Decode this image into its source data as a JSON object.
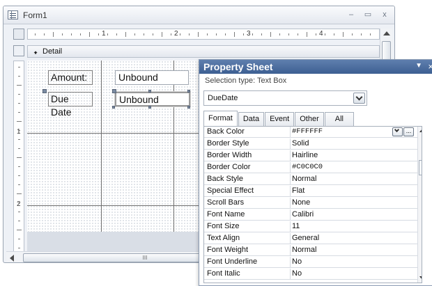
{
  "form_window": {
    "title": "Form1",
    "window_buttons": {
      "minimize": "–",
      "maximize": "▭",
      "close": "x"
    },
    "ruler_numbers": [
      "1",
      "2",
      "3",
      "4"
    ],
    "vruler_numbers": [
      "1",
      "2"
    ],
    "section_label": "Detail",
    "controls": [
      {
        "label": "Amount:",
        "textbox": "Unbound"
      },
      {
        "label": "Due Date",
        "textbox": "Unbound"
      }
    ],
    "scroll_grip": "III"
  },
  "property_sheet": {
    "title": "Property Sheet",
    "selection_type": "Selection type:  Text Box",
    "selected_object": "DueDate",
    "tabs": [
      "Format",
      "Data",
      "Event",
      "Other",
      "All"
    ],
    "active_tab": "Format",
    "properties": [
      {
        "name": "Back Color",
        "value": "#FFFFFF"
      },
      {
        "name": "Border Style",
        "value": "Solid"
      },
      {
        "name": "Border Width",
        "value": "Hairline"
      },
      {
        "name": "Border Color",
        "value": "#C0C0C0"
      },
      {
        "name": "Back Style",
        "value": "Normal"
      },
      {
        "name": "Special Effect",
        "value": "Flat"
      },
      {
        "name": "Scroll Bars",
        "value": "None"
      },
      {
        "name": "Font Name",
        "value": "Calibri"
      },
      {
        "name": "Font Size",
        "value": "11"
      },
      {
        "name": "Text Align",
        "value": "General"
      },
      {
        "name": "Font Weight",
        "value": "Normal"
      },
      {
        "name": "Font Underline",
        "value": "No"
      },
      {
        "name": "Font Italic",
        "value": "No"
      }
    ],
    "builder_button": "..."
  },
  "colors": {
    "ps_header": "#4a6c9f",
    "grid_dot": "#9aa6b6"
  }
}
